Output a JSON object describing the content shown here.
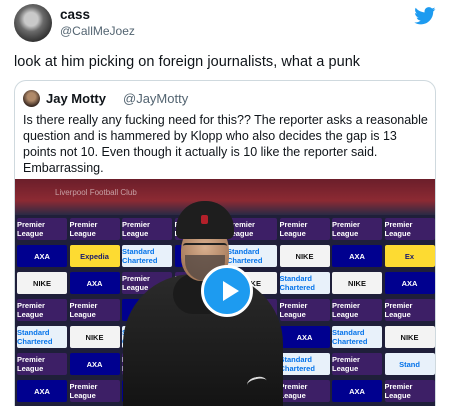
{
  "tweet": {
    "display_name": "cass",
    "handle": "@CallMeJoez",
    "text": "look at him picking on foreign journalists, what a punk"
  },
  "quoted_tweet": {
    "display_name": "Jay Motty",
    "handle": "@JayMotty",
    "text": "Is there really any fucking need for this?? The reporter asks a reasonable question and is hammered by Klopp who also decides the gap is 13 points not 10. Even though it actually is 10 like the reporter said. Embarrassing."
  },
  "media": {
    "type": "video",
    "backdrop_text": "Liverpool Football Club",
    "sponsor_tiles": [
      [
        "Premier League",
        "Premier League",
        "Premier League",
        "Premier League",
        "Premier League",
        "Premier League",
        "Premier League",
        "Premier League"
      ],
      [
        "AXA",
        "Expedia",
        "Standard Chartered",
        "AXA",
        "Standard Chartered",
        "NIKE",
        "AXA",
        "Ex"
      ],
      [
        "NIKE",
        "AXA",
        "Premier League",
        "Premier League",
        "NIKE",
        "Standard Chartered",
        "NIKE",
        "AXA"
      ],
      [
        "Premier League",
        "Premier League",
        "AXA",
        "Premier League",
        "Premier League",
        "Premier League",
        "Premier League",
        "Premier League"
      ],
      [
        "Standard Chartered",
        "NIKE",
        "Standard Chartered",
        "AXA",
        "NIKE",
        "AXA",
        "Standard Chartered",
        "NIKE"
      ],
      [
        "Premier League",
        "AXA",
        "Premier League",
        "Premier League",
        "Premier League",
        "Standard Chartered",
        "Premier League",
        "Stand"
      ],
      [
        "AXA",
        "Premier League",
        "AXA",
        "Premier League",
        "AXA",
        "Premier League",
        "AXA",
        "Premier League"
      ]
    ]
  },
  "icons": {
    "platform": "twitter-bird-icon",
    "play": "play-icon"
  },
  "colors": {
    "accent": "#1d9bf0",
    "handle_gray": "#536471"
  }
}
